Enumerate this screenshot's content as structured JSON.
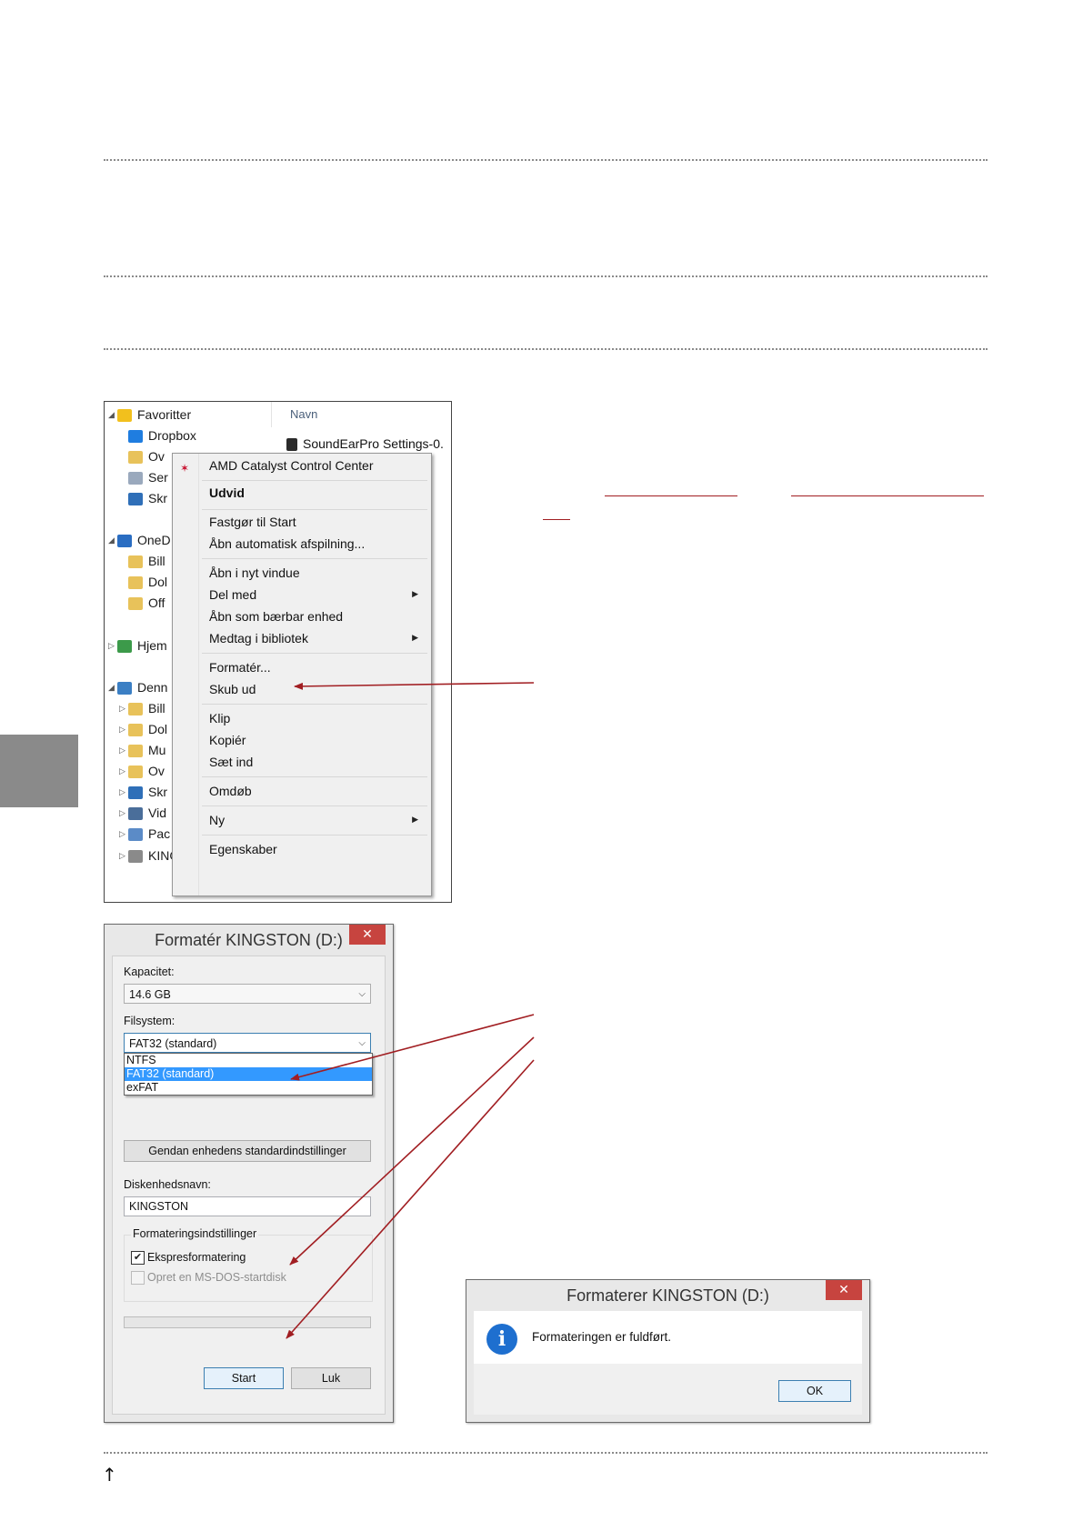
{
  "explorer": {
    "column_header": "Navn",
    "file_name": "SoundEarPro Settings-0.",
    "tree": [
      {
        "label": "Favoritter",
        "icon": "star-icon",
        "indent": 0,
        "expander": "◢"
      },
      {
        "label": "Dropbox",
        "icon": "dropbox-icon",
        "indent": 1,
        "expander": ""
      },
      {
        "label": "Ov",
        "icon": "folder-icon",
        "indent": 1,
        "expander": ""
      },
      {
        "label": "Ser",
        "icon": "recent-places-icon",
        "indent": 1,
        "expander": ""
      },
      {
        "label": "Skr",
        "icon": "desktop-icon",
        "indent": 1,
        "expander": ""
      },
      {
        "label": "OneD",
        "icon": "onedrive-icon",
        "indent": 0,
        "expander": "◢"
      },
      {
        "label": "Bill",
        "icon": "folder-icon",
        "indent": 1,
        "expander": ""
      },
      {
        "label": "Dol",
        "icon": "folder-icon",
        "indent": 1,
        "expander": ""
      },
      {
        "label": "Off",
        "icon": "folder-icon",
        "indent": 1,
        "expander": ""
      },
      {
        "label": "Hjem",
        "icon": "homegroup-icon",
        "indent": 0,
        "expander": "▷"
      },
      {
        "label": "Denn",
        "icon": "computer-icon",
        "indent": 0,
        "expander": "◢"
      },
      {
        "label": "Bill",
        "icon": "pictures-icon",
        "indent": 1,
        "expander": "▷"
      },
      {
        "label": "Dol",
        "icon": "documents-icon",
        "indent": 1,
        "expander": "▷"
      },
      {
        "label": "Mu",
        "icon": "music-icon",
        "indent": 1,
        "expander": "▷"
      },
      {
        "label": "Ov",
        "icon": "downloads-icon",
        "indent": 1,
        "expander": "▷"
      },
      {
        "label": "Skr",
        "icon": "desktop-icon",
        "indent": 1,
        "expander": "▷"
      },
      {
        "label": "Vid",
        "icon": "videos-icon",
        "indent": 1,
        "expander": "▷"
      },
      {
        "label": "Pac",
        "icon": "local-disk-icon",
        "indent": 1,
        "expander": "▷"
      },
      {
        "label": "KINGSTON (D:)",
        "icon": "usb-drive-icon",
        "indent": 1,
        "expander": "▷"
      }
    ]
  },
  "context_menu": {
    "items": [
      {
        "label": "AMD Catalyst Control Center",
        "bold": false,
        "submenu": false
      },
      {
        "label": "Udvid",
        "bold": true,
        "submenu": false
      },
      {
        "label": "Fastgør til Start",
        "bold": false,
        "submenu": false
      },
      {
        "label": "Åbn automatisk afspilning...",
        "bold": false,
        "submenu": false
      },
      {
        "label": "Åbn i nyt vindue",
        "bold": false,
        "submenu": false
      },
      {
        "label": "Del med",
        "bold": false,
        "submenu": true
      },
      {
        "label": "Åbn som bærbar enhed",
        "bold": false,
        "submenu": false
      },
      {
        "label": "Medtag i bibliotek",
        "bold": false,
        "submenu": true
      },
      {
        "label": "Formatér...",
        "bold": false,
        "submenu": false
      },
      {
        "label": "Skub ud",
        "bold": false,
        "submenu": false
      },
      {
        "label": "Klip",
        "bold": false,
        "submenu": false
      },
      {
        "label": "Kopiér",
        "bold": false,
        "submenu": false
      },
      {
        "label": "Sæt ind",
        "bold": false,
        "submenu": false
      },
      {
        "label": "Omdøb",
        "bold": false,
        "submenu": false
      },
      {
        "label": "Ny",
        "bold": false,
        "submenu": true
      },
      {
        "label": "Egenskaber",
        "bold": false,
        "submenu": false
      }
    ]
  },
  "format_dialog": {
    "title": "Formatér KINGSTON (D:)",
    "close_label": "✕",
    "capacity_label": "Kapacitet:",
    "capacity_value": "14.6 GB",
    "filesystem_label": "Filsystem:",
    "filesystem_value": "FAT32 (standard)",
    "filesystem_options": [
      "NTFS",
      "FAT32 (standard)",
      "exFAT"
    ],
    "selected_option": "FAT32 (standard)",
    "restore_button": "Gendan enhedens standardindstillinger",
    "volume_label": "Diskenhedsnavn:",
    "volume_value": "KINGSTON",
    "options_group": "Formateringsindstillinger",
    "quick_format": {
      "label": "Ekspresformatering",
      "checked": true
    },
    "msdos_startup": {
      "label": "Opret en MS-DOS-startdisk",
      "checked": false,
      "enabled": false
    },
    "progress": 0,
    "start_button": "Start",
    "close_button": "Luk"
  },
  "complete_dialog": {
    "title": "Formaterer KINGSTON (D:)",
    "close_label": "✕",
    "info_icon_glyph": "i",
    "message": "Formateringen er fuldført.",
    "ok_button": "OK"
  },
  "page": {
    "bottom_arrow": "↑",
    "accent_color": "#a11e22",
    "tab_color": "#8a8a8a"
  }
}
